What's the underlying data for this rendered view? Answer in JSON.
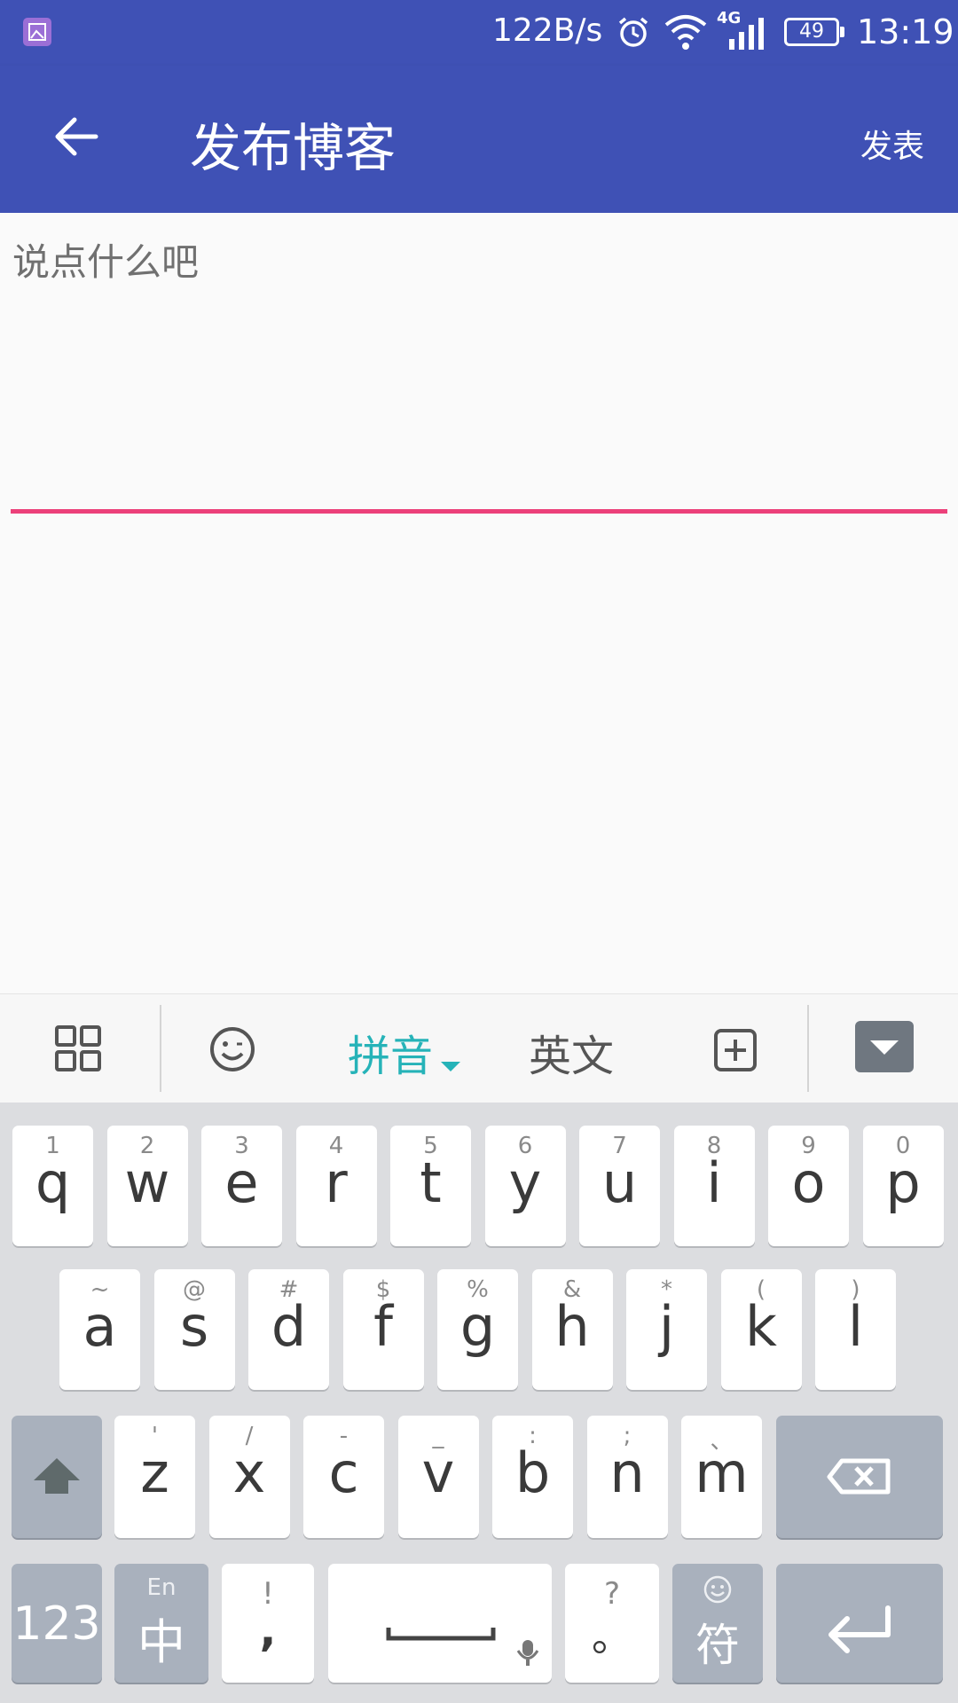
{
  "status": {
    "net_speed": "122B/s",
    "network": "4G",
    "battery": "49",
    "time": "13:19",
    "icons": [
      "gallery-notification-icon",
      "alarm-icon",
      "wifi-icon",
      "signal-icon",
      "battery-icon"
    ]
  },
  "toolbar": {
    "title": "发布博客",
    "action": "发表",
    "back_icon": "back-arrow-icon",
    "color": "#3f51b5"
  },
  "editor": {
    "placeholder": "说点什么吧",
    "underline_color": "#ec407a"
  },
  "ime_bar": {
    "pinyin": "拼音",
    "english": "英文",
    "accent": "#26b3b8",
    "icons": [
      "grid-icon",
      "emoji-icon",
      "add-box-icon",
      "hide-keyboard-icon"
    ]
  },
  "keyboard": {
    "row1": [
      {
        "hint": "1",
        "key": "q"
      },
      {
        "hint": "2",
        "key": "w"
      },
      {
        "hint": "3",
        "key": "e"
      },
      {
        "hint": "4",
        "key": "r"
      },
      {
        "hint": "5",
        "key": "t"
      },
      {
        "hint": "6",
        "key": "y"
      },
      {
        "hint": "7",
        "key": "u"
      },
      {
        "hint": "8",
        "key": "i"
      },
      {
        "hint": "9",
        "key": "o"
      },
      {
        "hint": "0",
        "key": "p"
      }
    ],
    "row2": [
      {
        "hint": "~",
        "key": "a"
      },
      {
        "hint": "@",
        "key": "s"
      },
      {
        "hint": "#",
        "key": "d"
      },
      {
        "hint": "$",
        "key": "f"
      },
      {
        "hint": "%",
        "key": "g"
      },
      {
        "hint": "&",
        "key": "h"
      },
      {
        "hint": "*",
        "key": "j"
      },
      {
        "hint": "(",
        "key": "k"
      },
      {
        "hint": ")",
        "key": "l"
      }
    ],
    "row3": [
      {
        "hint": "'",
        "key": "z"
      },
      {
        "hint": "/",
        "key": "x"
      },
      {
        "hint": "-",
        "key": "c"
      },
      {
        "hint": "_",
        "key": "v"
      },
      {
        "hint": ":",
        "key": "b"
      },
      {
        "hint": ";",
        "key": "n"
      },
      {
        "hint": "、",
        "key": "m"
      }
    ],
    "num_key": "123",
    "lang_hint": "En",
    "lang_key": "中",
    "comma_hint": "!",
    "comma_key": ",",
    "period_hint": "?",
    "period_key": "。",
    "symbol_key": "符"
  }
}
